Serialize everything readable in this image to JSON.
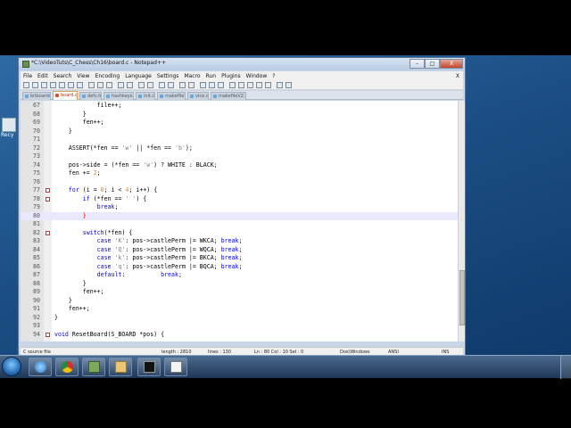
{
  "desktop": {
    "icon_label": "Recy"
  },
  "window": {
    "title": "*C:\\VideoTuts\\C_Chess\\Ch16\\board.c - Notepad++",
    "minimize_glyph": "–",
    "maximize_glyph": "□",
    "close_glyph": "X"
  },
  "menubar": {
    "items": [
      "File",
      "Edit",
      "Search",
      "View",
      "Encoding",
      "Language",
      "Settings",
      "Macro",
      "Run",
      "Plugins",
      "Window",
      "?"
    ],
    "close_glyph": "X"
  },
  "tabs": [
    {
      "label": "bitboards.c",
      "active": false
    },
    {
      "label": "board.c",
      "active": true
    },
    {
      "label": "defs.h",
      "active": false
    },
    {
      "label": "hashkeys.c",
      "active": false
    },
    {
      "label": "init.c",
      "active": false
    },
    {
      "label": "makefile",
      "active": false
    },
    {
      "label": "vice.c",
      "active": false
    },
    {
      "label": "makefileV2.txt",
      "active": false
    }
  ],
  "code_lines": [
    {
      "n": "67",
      "fold": false,
      "current": false
    },
    {
      "n": "68",
      "fold": false,
      "current": false
    },
    {
      "n": "69",
      "fold": false,
      "current": false
    },
    {
      "n": "70",
      "fold": false,
      "current": false
    },
    {
      "n": "71",
      "fold": false,
      "current": false
    },
    {
      "n": "72",
      "fold": false,
      "current": false
    },
    {
      "n": "73",
      "fold": false,
      "current": false
    },
    {
      "n": "74",
      "fold": false,
      "current": false
    },
    {
      "n": "75",
      "fold": false,
      "current": false
    },
    {
      "n": "76",
      "fold": false,
      "current": false
    },
    {
      "n": "77",
      "fold": true,
      "current": false
    },
    {
      "n": "78",
      "fold": true,
      "current": false
    },
    {
      "n": "79",
      "fold": false,
      "current": false
    },
    {
      "n": "80",
      "fold": false,
      "current": true
    },
    {
      "n": "81",
      "fold": false,
      "current": false
    },
    {
      "n": "82",
      "fold": true,
      "current": false
    },
    {
      "n": "83",
      "fold": false,
      "current": false
    },
    {
      "n": "84",
      "fold": false,
      "current": false
    },
    {
      "n": "85",
      "fold": false,
      "current": false
    },
    {
      "n": "86",
      "fold": false,
      "current": false
    },
    {
      "n": "87",
      "fold": false,
      "current": false
    },
    {
      "n": "88",
      "fold": false,
      "current": false
    },
    {
      "n": "89",
      "fold": false,
      "current": false
    },
    {
      "n": "90",
      "fold": false,
      "current": false
    },
    {
      "n": "91",
      "fold": false,
      "current": false
    },
    {
      "n": "92",
      "fold": false,
      "current": false
    },
    {
      "n": "93",
      "fold": false,
      "current": false
    },
    {
      "n": "94",
      "fold": true,
      "current": false
    },
    {
      "n": "95",
      "fold": false,
      "current": false
    }
  ],
  "code": {
    "l67": "            file++;",
    "l68": "        }",
    "l69": "        fen++;",
    "l70": "    }",
    "l71": "",
    "l72a": "    ASSERT(*fen == ",
    "l72b": "'w'",
    "l72c": " || *fen == ",
    "l72d": "'b'",
    "l72e": ");",
    "l73": "",
    "l74a": "    pos->side = (*fen == ",
    "l74b": "'w'",
    "l74c": ") ? WHITE : BLACK;",
    "l75a": "    fen += ",
    "l75b": "2",
    "l75c": ";",
    "l76": "",
    "l77a": "    ",
    "l77kw": "for",
    "l77b": " (i = ",
    "l77c": "0",
    "l77d": "; i < ",
    "l77e": "4",
    "l77f": "; i++) {",
    "l78a": "        ",
    "l78kw": "if",
    "l78b": " (*fen == ",
    "l78c": "' '",
    "l78d": ") {",
    "l79a": "            ",
    "l79kw": "break",
    "l79b": ";",
    "l80a": "        ",
    "l80b": "}",
    "l81": "",
    "l82a": "        ",
    "l82kw": "switch",
    "l82b": "(*fen) {",
    "sw": [
      {
        "pad": "            ",
        "kw": "case",
        "ch": " 'K'",
        "rest": ": pos->castlePerm |= WKCA; ",
        "brk": "break",
        "end": ";"
      },
      {
        "pad": "            ",
        "kw": "case",
        "ch": " 'Q'",
        "rest": ": pos->castlePerm |= WQCA; ",
        "brk": "break",
        "end": ";"
      },
      {
        "pad": "            ",
        "kw": "case",
        "ch": " 'k'",
        "rest": ": pos->castlePerm |= BKCA; ",
        "brk": "break",
        "end": ";"
      },
      {
        "pad": "            ",
        "kw": "case",
        "ch": " 'q'",
        "rest": ": pos->castlePerm |= BQCA; ",
        "brk": "break",
        "end": ";"
      }
    ],
    "l87a": "            ",
    "l87kw": "default",
    "l87b": ":          ",
    "l87brk": "break",
    "l87c": ";",
    "l88": "        }",
    "l89": "        fen++;",
    "l90": "    }",
    "l91": "    fen++;",
    "l92": "}",
    "l93": "",
    "l94kw": "void",
    "l94b": " ResetBoard(S_BOARD *pos) {",
    "l95": ""
  },
  "statusbar": {
    "filetype": "C source file",
    "length": "length : 2810",
    "lines": "lines : 130",
    "position": "Ln : 80   Col : 10   Sel : 0",
    "eol": "Dos\\Windows",
    "encoding": "ANSI",
    "mode": "INS"
  }
}
